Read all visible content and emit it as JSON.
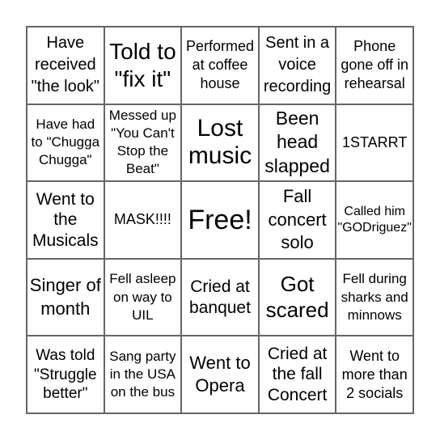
{
  "board": {
    "rows": [
      [
        {
          "text": "Have received \"the look\""
        },
        {
          "text": "Told to \"fix it\""
        },
        {
          "text": "Performed at coffee house"
        },
        {
          "text": "Sent in a voice recording"
        },
        {
          "text": "Phone gone off in rehearsal"
        }
      ],
      [
        {
          "text": "Have had to \"Chugga Chugga\""
        },
        {
          "text": "Messed up \"You Can't Stop the Beat\""
        },
        {
          "text": "Lost music"
        },
        {
          "text": "Been head slapped"
        },
        {
          "text": "1STARRT"
        }
      ],
      [
        {
          "text": "Went to the Musicals"
        },
        {
          "text": "MASK!!!!"
        },
        {
          "text": "Free!"
        },
        {
          "text": "Fall concert solo"
        },
        {
          "text": "Called him \"GODriguez\""
        }
      ],
      [
        {
          "text": "Singer of month"
        },
        {
          "text": "Fell asleep on way to UIL"
        },
        {
          "text": "Cried at banquet"
        },
        {
          "text": "Got scared"
        },
        {
          "text": "Fell during sharks and minnows"
        }
      ],
      [
        {
          "text": "Was told \"Struggle better\""
        },
        {
          "text": "Sang party in the USA on the bus"
        },
        {
          "text": "Went to Opera"
        },
        {
          "text": "Cried at the fall Concert"
        },
        {
          "text": "Went to more than 2 socials"
        }
      ]
    ]
  }
}
